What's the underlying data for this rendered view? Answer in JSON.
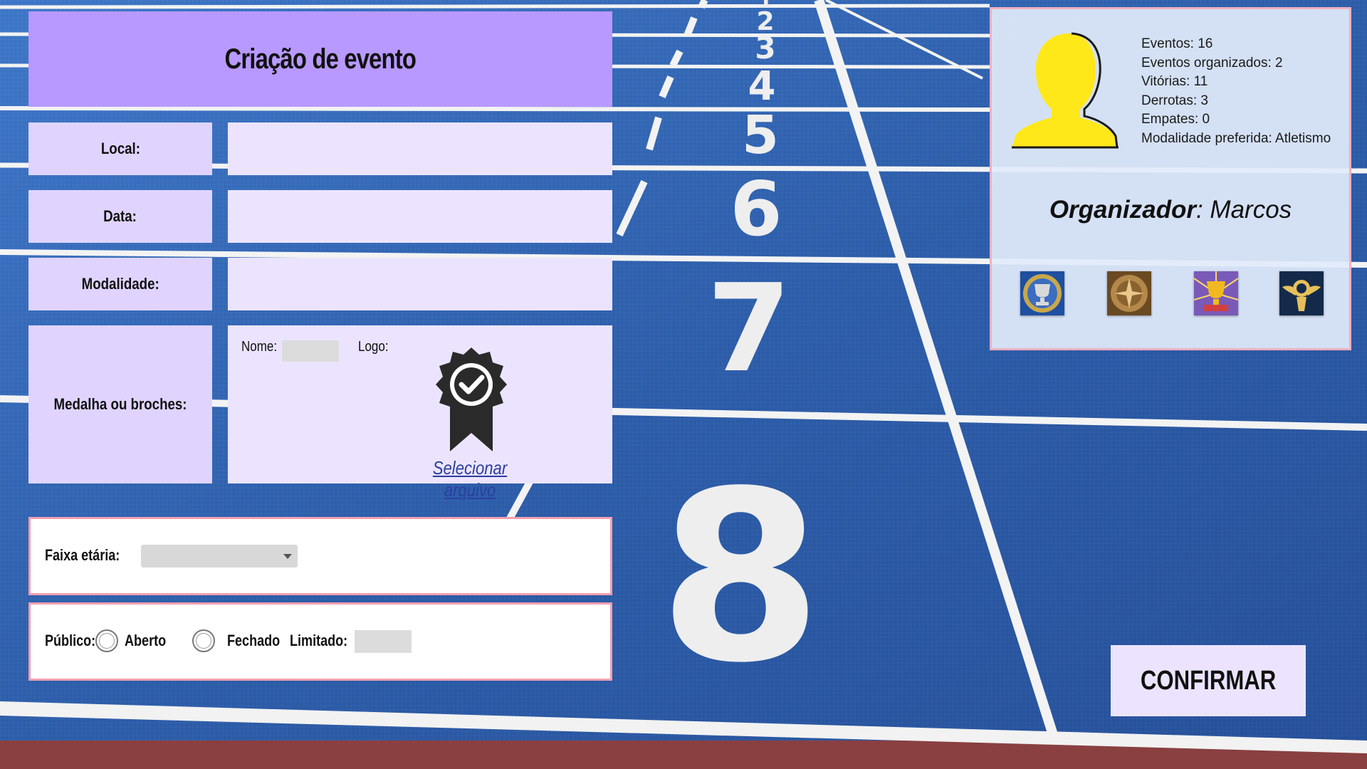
{
  "form": {
    "title": "Criação de evento",
    "local_label": "Local:",
    "local_value": "",
    "data_label": "Data:",
    "data_value": "",
    "modalidade_label": "Modalidade:",
    "modalidade_value": "",
    "medal_label": "Medalha ou broches:",
    "nome_label": "Nome:",
    "logo_label": "Logo:",
    "logo_icon": "award-badge-icon",
    "select_file": "Selecionar arquivo",
    "faixa_label": "Faixa etária:",
    "faixa_value": "",
    "publico_label": "Público:",
    "aberto_label": "Aberto",
    "fechado_label": "Fechado",
    "limitado_label": "Limitado:",
    "limitado_value": ""
  },
  "profile": {
    "avatar_icon": "user-silhouette-icon",
    "stats": [
      "Eventos: 16",
      "Eventos organizados: 2",
      "Vitórias: 11",
      "Derrotas: 3",
      "Empates: 0",
      "Modalidade preferida: Atletismo"
    ],
    "organizer_label": "Organizador",
    "organizer_name": ": Marcos",
    "medals": [
      "trophy-medal-icon",
      "compass-medal-icon",
      "cup-medal-icon",
      "winged-medal-icon"
    ]
  },
  "confirm_label": "CONFIRMAR",
  "colors": {
    "title_bg": "#b899ff",
    "label_bg": "#e0d4ff",
    "field_bg": "#ece4ff",
    "pink_border": "#f0a0b0",
    "track_blue": "#2f5ea8"
  }
}
